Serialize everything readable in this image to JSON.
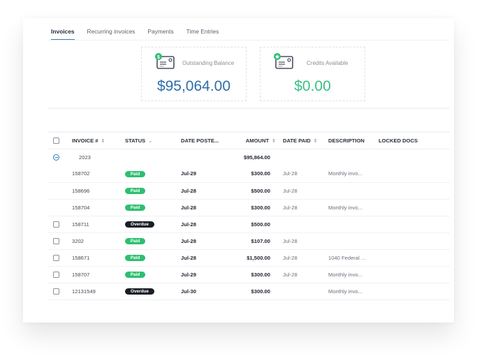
{
  "tabs": [
    {
      "label": "Invoices",
      "active": true
    },
    {
      "label": "Recurring invoices",
      "active": false
    },
    {
      "label": "Payments",
      "active": false
    },
    {
      "label": "Time Entries",
      "active": false
    }
  ],
  "stats": {
    "outstanding": {
      "label": "Outstanding Balance",
      "value": "$95,064.00",
      "icon": "invoice-dollar-icon",
      "color": "#2f6ea8"
    },
    "credits": {
      "label": "Credits Available",
      "value": "$0.00",
      "icon": "invoice-star-icon",
      "color": "#3bbf84"
    }
  },
  "table": {
    "columns": {
      "invoice": "INVOICE #",
      "status": "STATUS",
      "date_posted": "DATE POSTE...",
      "amount": "AMOUNT",
      "date_paid": "DATE PAID",
      "description": "DESCRIPTION",
      "locked_docs": "LOCKED DOCS"
    },
    "group": {
      "year": "2023",
      "total": "$95,864.00"
    },
    "rows": [
      {
        "invoice": "158702",
        "status": "Paid",
        "date_posted": "Jul-29",
        "amount": "$300.00",
        "date_paid": "Jul-28",
        "description": "Monthly invo...",
        "checkbox": false
      },
      {
        "invoice": "158696",
        "status": "Paid",
        "date_posted": "Jul-28",
        "amount": "$500.00",
        "date_paid": "Jul-28",
        "description": "",
        "checkbox": false
      },
      {
        "invoice": "158704",
        "status": "Paid",
        "date_posted": "Jul-28",
        "amount": "$300.00",
        "date_paid": "Jul-28",
        "description": "Monthly invo...",
        "checkbox": false
      },
      {
        "invoice": "158711",
        "status": "Overdue",
        "date_posted": "Jul-28",
        "amount": "$500.00",
        "date_paid": "",
        "description": "",
        "checkbox": true
      },
      {
        "invoice": "3202",
        "status": "Paid",
        "date_posted": "Jul-28",
        "amount": "$107.00",
        "date_paid": "Jul-28",
        "description": "",
        "checkbox": true
      },
      {
        "invoice": "158671",
        "status": "Paid",
        "date_posted": "Jul-28",
        "amount": "$1,500.00",
        "date_paid": "Jul-28",
        "description": "1040 Federal ...",
        "checkbox": true
      },
      {
        "invoice": "158707",
        "status": "Paid",
        "date_posted": "Jul-29",
        "amount": "$300.00",
        "date_paid": "Jul-28",
        "description": "Monthly invo...",
        "checkbox": true
      },
      {
        "invoice": "12131549",
        "status": "Overdue",
        "date_posted": "Jul-30",
        "amount": "$300.00",
        "date_paid": "",
        "description": "Monthly invo...",
        "checkbox": true
      }
    ]
  },
  "colors": {
    "paid": "#2fbf71",
    "overdue": "#1b1e26",
    "accent": "#3a7bbf"
  }
}
